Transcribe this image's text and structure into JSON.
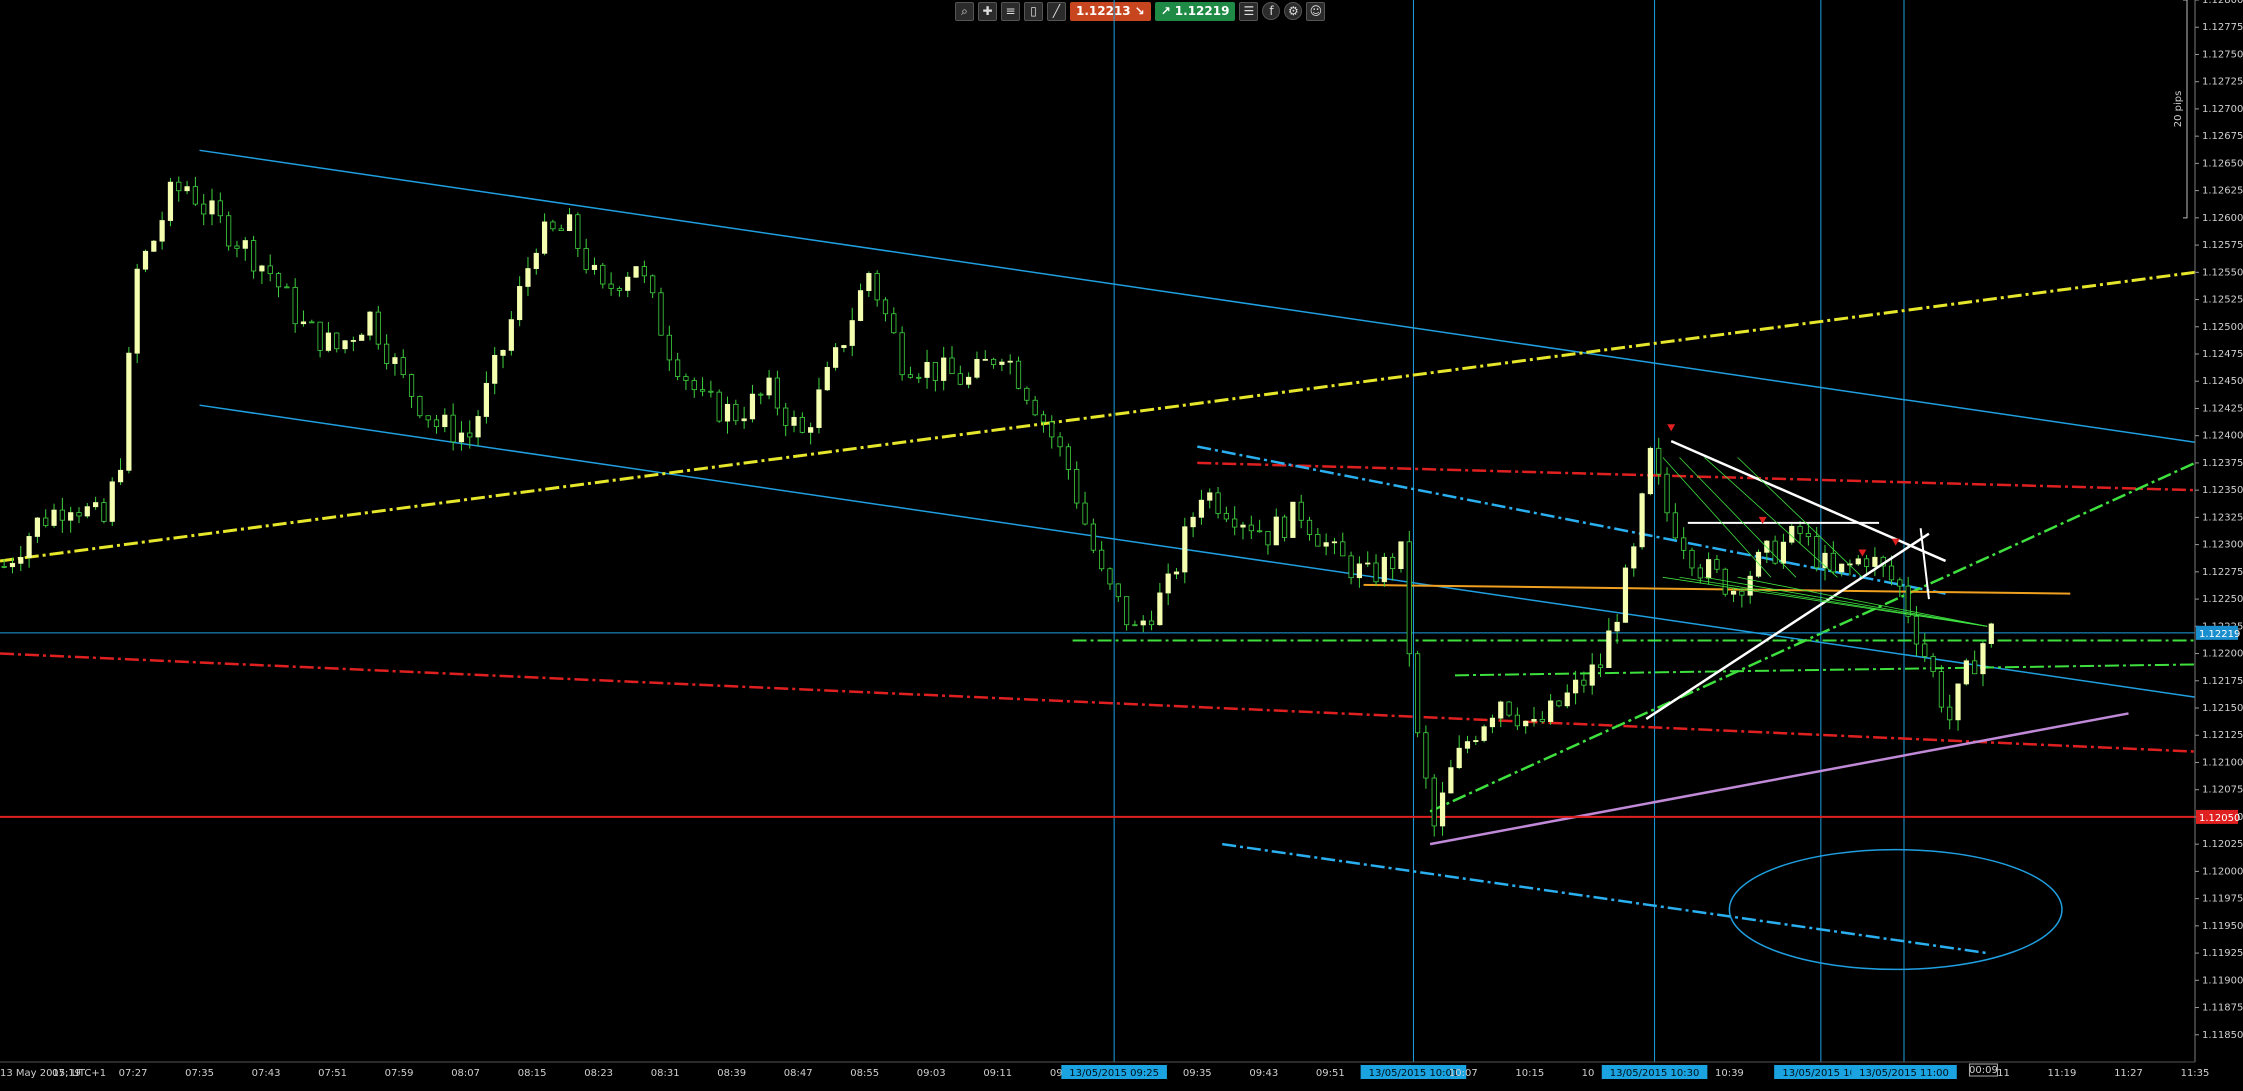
{
  "toolbar": {
    "bid_price": "1.12213",
    "ask_price": "1.12219",
    "icons": [
      "zoom-icon",
      "crosshair-icon",
      "bars-icon",
      "candle-icon",
      "line-tool-icon",
      "bid-arrow-icon",
      "ask-arrow-icon",
      "list-icon",
      "facebook-icon",
      "settings-icon",
      "profile-icon"
    ]
  },
  "colors": {
    "background": "#000000",
    "bull_candle": "#f4ffb0",
    "wick": "#3fd23f",
    "channel": "#1f9fe0",
    "trend_yellow": "#e6e62a",
    "trend_red": "#e02020",
    "trend_green": "#3ee03e",
    "trend_purple": "#c08ad8",
    "trend_orange": "#f0a020",
    "pattern_white": "#ffffff",
    "current_price_tag": "#1a8fd0",
    "level_price_tag": "#e02020"
  },
  "chart_data": {
    "type": "candlestick",
    "title": "",
    "xlabel": "",
    "ylabel": "",
    "ylim": [
      1.11825,
      1.128
    ],
    "grid": false,
    "y_ticks": [
      "1.12800",
      "1.12775",
      "1.12750",
      "1.12725",
      "1.12700",
      "1.12675",
      "1.12650",
      "1.12625",
      "1.12600",
      "1.12575",
      "1.12550",
      "1.12525",
      "1.12500",
      "1.12475",
      "1.12450",
      "1.12425",
      "1.12400",
      "1.12375",
      "1.12350",
      "1.12325",
      "1.12300",
      "1.12275",
      "1.12250",
      "1.12225",
      "1.12200",
      "1.12175",
      "1.12150",
      "1.12125",
      "1.12100",
      "1.12075",
      "1.12050",
      "1.12025",
      "1.12000",
      "1.11975",
      "1.11950",
      "1.11925",
      "1.11900",
      "1.11875",
      "1.11850"
    ],
    "x_ticks": [
      "13 May 2015, UTC+1",
      "07:19",
      "07:27",
      "07:35",
      "07:43",
      "07:51",
      "07:59",
      "08:07",
      "08:15",
      "08:23",
      "08:31",
      "08:39",
      "08:47",
      "08:55",
      "09:03",
      "09:11",
      "09:19",
      "13/05/2015 09:25",
      "09:35",
      "09:43",
      "09:51",
      "13/05/2015 10:01",
      "10:07",
      "10:15",
      "10",
      "13/05/2015 10:30",
      "10:39",
      "13/05/2015 10:",
      "13/05/2015 11:00",
      "11:11",
      "11:19",
      "11:27",
      "11:35"
    ],
    "time_range": [
      "07:11",
      "11:35"
    ],
    "scale_label": "20 pips",
    "timer_label": "00:09",
    "current_price": "1.12219",
    "level_price_label": "1.12050",
    "close_path": [
      {
        "t": "07:11",
        "p": 1.1228
      },
      {
        "t": "07:15",
        "p": 1.1232
      },
      {
        "t": "07:19",
        "p": 1.1234
      },
      {
        "t": "07:23",
        "p": 1.1232
      },
      {
        "t": "07:25",
        "p": 1.1238
      },
      {
        "t": "07:27",
        "p": 1.1255
      },
      {
        "t": "07:29",
        "p": 1.1258
      },
      {
        "t": "07:31",
        "p": 1.1262
      },
      {
        "t": "07:33",
        "p": 1.1263
      },
      {
        "t": "07:35",
        "p": 1.1261
      },
      {
        "t": "07:39",
        "p": 1.1258
      },
      {
        "t": "07:43",
        "p": 1.1255
      },
      {
        "t": "07:47",
        "p": 1.125
      },
      {
        "t": "07:51",
        "p": 1.1248
      },
      {
        "t": "07:55",
        "p": 1.1251
      },
      {
        "t": "07:59",
        "p": 1.1245
      },
      {
        "t": "08:03",
        "p": 1.1241
      },
      {
        "t": "08:07",
        "p": 1.124
      },
      {
        "t": "08:11",
        "p": 1.1248
      },
      {
        "t": "08:15",
        "p": 1.1258
      },
      {
        "t": "08:19",
        "p": 1.1259
      },
      {
        "t": "08:23",
        "p": 1.1253
      },
      {
        "t": "08:27",
        "p": 1.1256
      },
      {
        "t": "08:31",
        "p": 1.1248
      },
      {
        "t": "08:35",
        "p": 1.1243
      },
      {
        "t": "08:39",
        "p": 1.1242
      },
      {
        "t": "08:43",
        "p": 1.1244
      },
      {
        "t": "08:47",
        "p": 1.124
      },
      {
        "t": "08:51",
        "p": 1.1247
      },
      {
        "t": "08:55",
        "p": 1.1255
      },
      {
        "t": "08:59",
        "p": 1.1247
      },
      {
        "t": "09:03",
        "p": 1.1246
      },
      {
        "t": "09:07",
        "p": 1.1245
      },
      {
        "t": "09:11",
        "p": 1.1248
      },
      {
        "t": "09:15",
        "p": 1.1243
      },
      {
        "t": "09:19",
        "p": 1.1237
      },
      {
        "t": "09:23",
        "p": 1.1227
      },
      {
        "t": "09:27",
        "p": 1.1222
      },
      {
        "t": "09:31",
        "p": 1.1226
      },
      {
        "t": "09:35",
        "p": 1.1235
      },
      {
        "t": "09:39",
        "p": 1.1233
      },
      {
        "t": "09:43",
        "p": 1.1231
      },
      {
        "t": "09:47",
        "p": 1.1233
      },
      {
        "t": "09:51",
        "p": 1.1229
      },
      {
        "t": "09:55",
        "p": 1.1227
      },
      {
        "t": "09:59",
        "p": 1.1229
      },
      {
        "t": "10:01",
        "p": 1.1212
      },
      {
        "t": "10:03",
        "p": 1.1204
      },
      {
        "t": "10:05",
        "p": 1.1209
      },
      {
        "t": "10:07",
        "p": 1.1212
      },
      {
        "t": "10:11",
        "p": 1.1216
      },
      {
        "t": "10:15",
        "p": 1.1213
      },
      {
        "t": "10:19",
        "p": 1.1216
      },
      {
        "t": "10:23",
        "p": 1.1219
      },
      {
        "t": "10:27",
        "p": 1.1229
      },
      {
        "t": "10:29",
        "p": 1.1238
      },
      {
        "t": "10:31",
        "p": 1.1233
      },
      {
        "t": "10:35",
        "p": 1.1228
      },
      {
        "t": "10:39",
        "p": 1.1226
      },
      {
        "t": "10:43",
        "p": 1.1229
      },
      {
        "t": "10:47",
        "p": 1.1231
      },
      {
        "t": "10:51",
        "p": 1.1227
      },
      {
        "t": "10:55",
        "p": 1.1229
      },
      {
        "t": "10:59",
        "p": 1.1226
      },
      {
        "t": "11:01",
        "p": 1.1222
      },
      {
        "t": "11:03",
        "p": 1.1218
      },
      {
        "t": "11:05",
        "p": 1.1214
      },
      {
        "t": "11:07",
        "p": 1.1218
      },
      {
        "t": "11:09",
        "p": 1.1221
      },
      {
        "t": "11:10",
        "p": 1.1222
      }
    ]
  }
}
